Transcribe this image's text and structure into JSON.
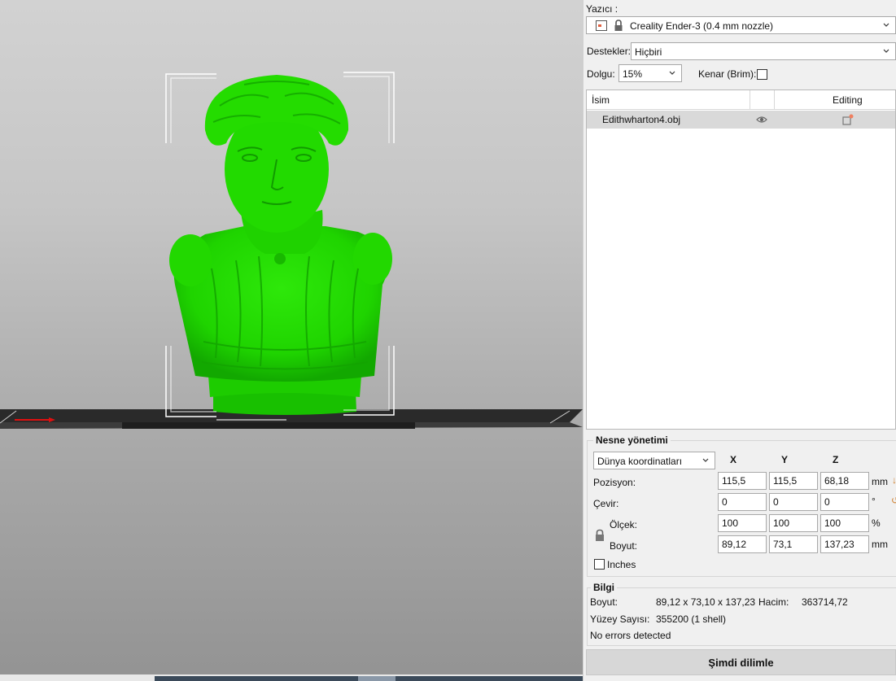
{
  "sidebar": {
    "printer_label": "Yazıcı :",
    "printer_value": "Creality Ender-3 (0.4 mm nozzle)",
    "supports_label": "Destekler:",
    "supports_value": "Hiçbiri",
    "infill_label": "Dolgu:",
    "infill_value": "15%",
    "brim_label": "Kenar (Brim):",
    "brim_checked": false
  },
  "object_list": {
    "col_name": "İsim",
    "col_editing": "Editing",
    "rows": [
      {
        "name": "Edithwharton4.obj"
      }
    ]
  },
  "object_manipulation": {
    "title": "Nesne yönetimi",
    "coordinate_system": "Dünya koordinatları",
    "axes": {
      "x": "X",
      "y": "Y",
      "z": "Z"
    },
    "position": {
      "label": "Pozisyon:",
      "x": "115,5",
      "y": "115,5",
      "z": "68,18",
      "unit": "mm"
    },
    "rotation": {
      "label": "Çevir:",
      "x": "0",
      "y": "0",
      "z": "0",
      "unit": "°"
    },
    "scale": {
      "label": "Ölçek:",
      "x": "100",
      "y": "100",
      "z": "100",
      "unit": "%"
    },
    "size": {
      "label": "Boyut:",
      "x": "89,12",
      "y": "73,1",
      "z": "137,23",
      "unit": "mm"
    },
    "inches_label": "Inches"
  },
  "info": {
    "title": "Bilgi",
    "size_label": "Boyut:",
    "size_value": "89,12 x 73,10 x 137,23",
    "volume_label": "Hacim:",
    "volume_value": "363714,72",
    "facets_label": "Yüzey Sayısı:",
    "facets_value": "355200 (1 shell)",
    "errors": "No errors detected"
  },
  "slice_button": "Şimdi dilimle",
  "colors": {
    "model": "#22dd00",
    "model_dark": "#12a500",
    "bed": "#3a3a3a",
    "x_axis": "#e01010"
  }
}
